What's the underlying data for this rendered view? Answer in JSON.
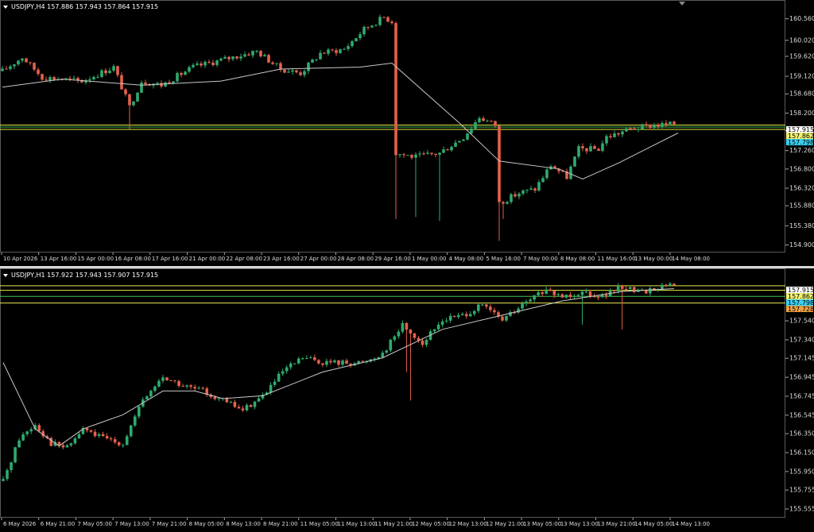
{
  "colors": {
    "background": "#000000",
    "bull": "#2faa6e",
    "bear": "#e5614b",
    "ma": "#c8c8c8",
    "axis_text": "#dcdcdc",
    "line_yellow": "#e8e84a",
    "line_green": "#46c25a",
    "label_cyan": "#3ad0f0",
    "label_yellow": "#f0f070",
    "label_orange": "#f0a040",
    "label_white": "#ffffff"
  },
  "chart_data": [
    {
      "type": "candlestick",
      "title": "USDJPY,H4  157.886 157.943 157.864 157.915",
      "symbol": "USDJPY",
      "timeframe": "H4",
      "ohlc_header": {
        "open": "157.886",
        "high": "157.943",
        "low": "157.864",
        "close": "157.915"
      },
      "ylim": [
        154.75,
        160.95
      ],
      "y_ticks": [
        "160.560",
        "160.020",
        "159.620",
        "159.120",
        "158.680",
        "158.200",
        "157.760",
        "157.260",
        "156.800",
        "156.320",
        "155.880",
        "155.380",
        "154.900"
      ],
      "x_ticks": [
        "10 Apr 2026",
        "13 Apr 16:00",
        "15 Apr 00:00",
        "16 Apr 08:00",
        "17 Apr 16:00",
        "21 Apr 00:00",
        "22 Apr 08:00",
        "23 Apr 16:00",
        "27 Apr 00:00",
        "28 Apr 08:00",
        "29 Apr 16:00",
        "1 May 00:00",
        "4 May 08:00",
        "5 May 16:00",
        "7 May 00:00",
        "8 May 08:00",
        "11 May 16:00",
        "13 May 00:00",
        "14 May 08:00"
      ],
      "price_labels": [
        {
          "value": "157.915",
          "color_key": "label_white"
        },
        {
          "value": "157.862",
          "color_key": "label_yellow"
        },
        {
          "value": "157.798",
          "color_key": "label_cyan"
        }
      ],
      "horizontal_lines": [
        {
          "value": 157.9,
          "color_key": "line_yellow"
        },
        {
          "value": 157.85,
          "color_key": "line_green"
        },
        {
          "value": 157.79,
          "color_key": "line_yellow"
        }
      ],
      "anchors": [
        {
          "i": 0,
          "p": 159.25
        },
        {
          "i": 5,
          "p": 159.6
        },
        {
          "i": 10,
          "p": 159.1
        },
        {
          "i": 20,
          "p": 159.0
        },
        {
          "i": 28,
          "p": 159.35
        },
        {
          "i": 32,
          "p": 158.35
        },
        {
          "i": 35,
          "p": 159.0
        },
        {
          "i": 40,
          "p": 158.9
        },
        {
          "i": 48,
          "p": 159.35
        },
        {
          "i": 56,
          "p": 159.55
        },
        {
          "i": 64,
          "p": 159.75
        },
        {
          "i": 70,
          "p": 159.3
        },
        {
          "i": 75,
          "p": 159.2
        },
        {
          "i": 80,
          "p": 159.7
        },
        {
          "i": 86,
          "p": 159.8
        },
        {
          "i": 91,
          "p": 160.3
        },
        {
          "i": 96,
          "p": 160.6
        },
        {
          "i": 98,
          "p": 160.5
        },
        {
          "i": 99,
          "p": 157.2
        },
        {
          "i": 104,
          "p": 157.1
        },
        {
          "i": 110,
          "p": 157.2
        },
        {
          "i": 116,
          "p": 157.6
        },
        {
          "i": 120,
          "p": 158.1
        },
        {
          "i": 124,
          "p": 157.9
        },
        {
          "i": 125,
          "p": 155.95
        },
        {
          "i": 130,
          "p": 156.2
        },
        {
          "i": 134,
          "p": 156.3
        },
        {
          "i": 138,
          "p": 156.9
        },
        {
          "i": 142,
          "p": 156.6
        },
        {
          "i": 145,
          "p": 157.3
        },
        {
          "i": 150,
          "p": 157.3
        },
        {
          "i": 152,
          "p": 157.6
        },
        {
          "i": 158,
          "p": 157.8
        },
        {
          "i": 164,
          "p": 157.9
        },
        {
          "i": 169,
          "p": 157.92
        }
      ],
      "moving_average": [
        {
          "i": 0,
          "p": 158.85
        },
        {
          "i": 15,
          "p": 159.05
        },
        {
          "i": 35,
          "p": 158.9
        },
        {
          "i": 55,
          "p": 159.0
        },
        {
          "i": 70,
          "p": 159.3
        },
        {
          "i": 90,
          "p": 159.35
        },
        {
          "i": 98,
          "p": 159.45
        },
        {
          "i": 115,
          "p": 157.95
        },
        {
          "i": 125,
          "p": 157.0
        },
        {
          "i": 140,
          "p": 156.8
        },
        {
          "i": 146,
          "p": 156.55
        },
        {
          "i": 155,
          "p": 156.95
        },
        {
          "i": 165,
          "p": 157.45
        },
        {
          "i": 170,
          "p": 157.7
        }
      ],
      "spikes": [
        {
          "i": 32,
          "low": 157.8
        },
        {
          "i": 99,
          "low": 155.55
        },
        {
          "i": 104,
          "low": 155.6
        },
        {
          "i": 110,
          "low": 155.5
        },
        {
          "i": 125,
          "low": 155.0
        },
        {
          "i": 126,
          "low": 155.55
        }
      ]
    },
    {
      "type": "candlestick",
      "title": "USDJPY,H1  157.922 157.943 157.907 157.915",
      "symbol": "USDJPY",
      "timeframe": "H1",
      "ohlc_header": {
        "open": "157.922",
        "high": "157.943",
        "low": "157.907",
        "close": "157.915"
      },
      "ylim": [
        155.48,
        158.06
      ],
      "y_ticks": [
        "157.540",
        "157.340",
        "157.145",
        "156.945",
        "156.745",
        "156.545",
        "156.350",
        "156.150",
        "155.950",
        "155.755",
        "155.555"
      ],
      "x_ticks": [
        "6 May 2026",
        "6 May 21:00",
        "7 May 05:00",
        "7 May 13:00",
        "7 May 21:00",
        "8 May 05:00",
        "8 May 13:00",
        "8 May 21:00",
        "11 May 05:00",
        "11 May 13:00",
        "11 May 21:00",
        "12 May 05:00",
        "12 May 13:00",
        "12 May 21:00",
        "13 May 05:00",
        "13 May 13:00",
        "13 May 21:00",
        "14 May 05:00",
        "14 May 13:00"
      ],
      "price_labels": [
        {
          "value": "157.915",
          "color_key": "label_white"
        },
        {
          "value": "157.862",
          "color_key": "label_yellow"
        },
        {
          "value": "157.798",
          "color_key": "label_cyan"
        },
        {
          "value": "157.728",
          "color_key": "label_orange"
        }
      ],
      "horizontal_lines": [
        {
          "value": 157.91,
          "color_key": "line_yellow"
        },
        {
          "value": 157.862,
          "color_key": "line_yellow"
        },
        {
          "value": 157.798,
          "color_key": "line_green"
        },
        {
          "value": 157.728,
          "color_key": "line_yellow"
        }
      ],
      "anchors": [
        {
          "i": 0,
          "p": 155.85
        },
        {
          "i": 4,
          "p": 156.3
        },
        {
          "i": 8,
          "p": 156.45
        },
        {
          "i": 12,
          "p": 156.25
        },
        {
          "i": 16,
          "p": 156.2
        },
        {
          "i": 20,
          "p": 156.4
        },
        {
          "i": 25,
          "p": 156.3
        },
        {
          "i": 30,
          "p": 156.25
        },
        {
          "i": 35,
          "p": 156.7
        },
        {
          "i": 40,
          "p": 156.95
        },
        {
          "i": 45,
          "p": 156.85
        },
        {
          "i": 50,
          "p": 156.8
        },
        {
          "i": 55,
          "p": 156.7
        },
        {
          "i": 60,
          "p": 156.6
        },
        {
          "i": 65,
          "p": 156.75
        },
        {
          "i": 70,
          "p": 157.0
        },
        {
          "i": 75,
          "p": 157.15
        },
        {
          "i": 80,
          "p": 157.1
        },
        {
          "i": 85,
          "p": 157.1
        },
        {
          "i": 90,
          "p": 157.1
        },
        {
          "i": 95,
          "p": 157.2
        },
        {
          "i": 100,
          "p": 157.5
        },
        {
          "i": 105,
          "p": 157.3
        },
        {
          "i": 110,
          "p": 157.55
        },
        {
          "i": 115,
          "p": 157.6
        },
        {
          "i": 120,
          "p": 157.7
        },
        {
          "i": 125,
          "p": 157.55
        },
        {
          "i": 130,
          "p": 157.7
        },
        {
          "i": 135,
          "p": 157.85
        },
        {
          "i": 140,
          "p": 157.8
        },
        {
          "i": 145,
          "p": 157.85
        },
        {
          "i": 150,
          "p": 157.8
        },
        {
          "i": 155,
          "p": 157.9
        },
        {
          "i": 160,
          "p": 157.85
        },
        {
          "i": 165,
          "p": 157.9
        },
        {
          "i": 168,
          "p": 157.915
        }
      ],
      "moving_average": [
        {
          "i": 0,
          "p": 157.1
        },
        {
          "i": 8,
          "p": 156.4
        },
        {
          "i": 14,
          "p": 156.22
        },
        {
          "i": 20,
          "p": 156.4
        },
        {
          "i": 30,
          "p": 156.55
        },
        {
          "i": 40,
          "p": 156.8
        },
        {
          "i": 48,
          "p": 156.8
        },
        {
          "i": 55,
          "p": 156.72
        },
        {
          "i": 65,
          "p": 156.75
        },
        {
          "i": 80,
          "p": 157.0
        },
        {
          "i": 95,
          "p": 157.15
        },
        {
          "i": 110,
          "p": 157.45
        },
        {
          "i": 125,
          "p": 157.6
        },
        {
          "i": 140,
          "p": 157.75
        },
        {
          "i": 155,
          "p": 157.85
        },
        {
          "i": 168,
          "p": 157.88
        }
      ],
      "spikes": [
        {
          "i": 101,
          "low": 157.0
        },
        {
          "i": 102,
          "low": 156.7
        },
        {
          "i": 145,
          "low": 157.5
        },
        {
          "i": 155,
          "low": 157.45
        }
      ]
    }
  ]
}
